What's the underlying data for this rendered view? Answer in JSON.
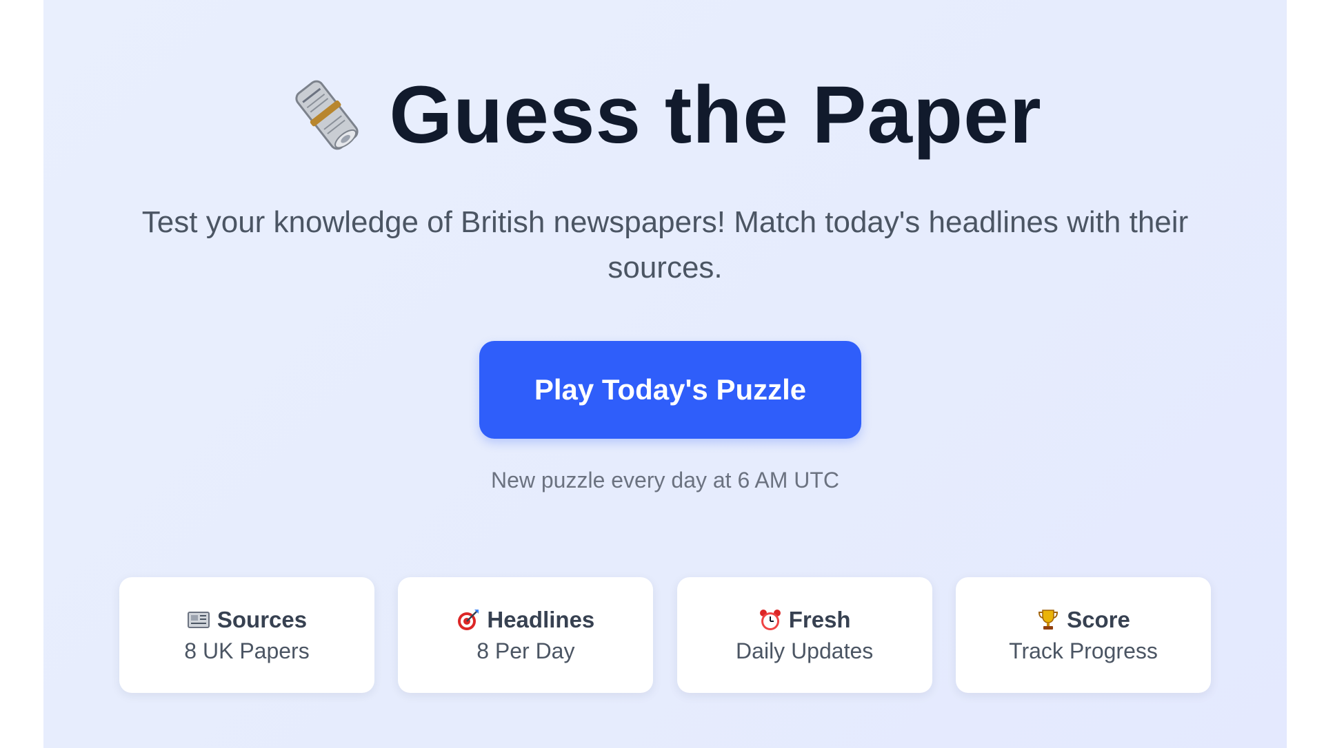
{
  "hero": {
    "icon": "rolled-newspaper-icon",
    "title": "Guess the Paper",
    "subtitle": "Test your knowledge of British newspapers! Match today's headlines with their sources."
  },
  "cta": {
    "label": "Play Today's Puzzle",
    "note": "New puzzle every day at 6 AM UTC"
  },
  "features": [
    {
      "icon": "newspaper-icon",
      "title": "Sources",
      "subtitle": "8 UK Papers"
    },
    {
      "icon": "target-icon",
      "title": "Headlines",
      "subtitle": "8 Per Day"
    },
    {
      "icon": "alarm-clock-icon",
      "title": "Fresh",
      "subtitle": "Daily Updates"
    },
    {
      "icon": "trophy-icon",
      "title": "Score",
      "subtitle": "Track Progress"
    }
  ],
  "colors": {
    "accent": "#2f5efa",
    "title": "#111a2c",
    "background": "#e8eefd"
  }
}
